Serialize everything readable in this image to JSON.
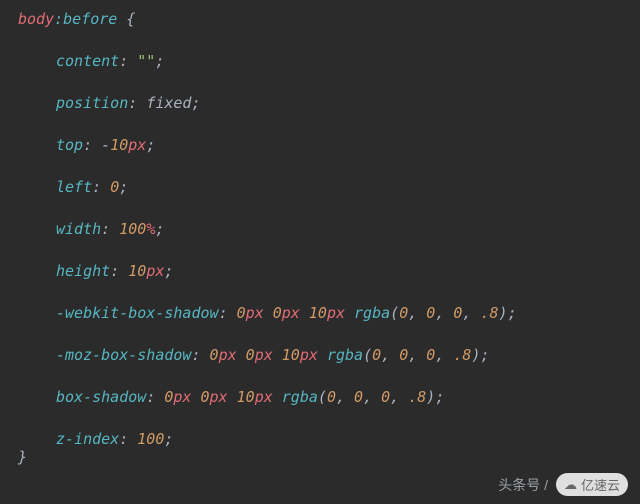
{
  "code": {
    "selector": "body",
    "pseudo": ":before",
    "open": " {",
    "close": "}",
    "decls": [
      {
        "prop": "content",
        "parts": [
          {
            "t": "str",
            "v": "\"\""
          }
        ]
      },
      {
        "prop": "position",
        "parts": [
          {
            "t": "val",
            "v": "fixed"
          }
        ]
      },
      {
        "prop": "top",
        "parts": [
          {
            "t": "punc",
            "v": "-"
          },
          {
            "t": "num",
            "v": "10"
          },
          {
            "t": "unit",
            "v": "px"
          }
        ]
      },
      {
        "prop": "left",
        "parts": [
          {
            "t": "num",
            "v": "0"
          }
        ]
      },
      {
        "prop": "width",
        "parts": [
          {
            "t": "num",
            "v": "100"
          },
          {
            "t": "unit",
            "v": "%"
          }
        ]
      },
      {
        "prop": "height",
        "parts": [
          {
            "t": "num",
            "v": "10"
          },
          {
            "t": "unit",
            "v": "px"
          }
        ]
      },
      {
        "prop": "-webkit-box-shadow",
        "parts": [
          {
            "t": "num",
            "v": "0"
          },
          {
            "t": "unit",
            "v": "px "
          },
          {
            "t": "num",
            "v": "0"
          },
          {
            "t": "unit",
            "v": "px "
          },
          {
            "t": "num",
            "v": "10"
          },
          {
            "t": "unit",
            "v": "px "
          },
          {
            "t": "func",
            "v": "rgba"
          },
          {
            "t": "punc",
            "v": "("
          },
          {
            "t": "num",
            "v": "0"
          },
          {
            "t": "punc",
            "v": ", "
          },
          {
            "t": "num",
            "v": "0"
          },
          {
            "t": "punc",
            "v": ", "
          },
          {
            "t": "num",
            "v": "0"
          },
          {
            "t": "punc",
            "v": ", "
          },
          {
            "t": "num",
            "v": ".8"
          },
          {
            "t": "punc",
            "v": ")"
          }
        ]
      },
      {
        "prop": "-moz-box-shadow",
        "parts": [
          {
            "t": "num",
            "v": "0"
          },
          {
            "t": "unit",
            "v": "px "
          },
          {
            "t": "num",
            "v": "0"
          },
          {
            "t": "unit",
            "v": "px "
          },
          {
            "t": "num",
            "v": "10"
          },
          {
            "t": "unit",
            "v": "px "
          },
          {
            "t": "func",
            "v": "rgba"
          },
          {
            "t": "punc",
            "v": "("
          },
          {
            "t": "num",
            "v": "0"
          },
          {
            "t": "punc",
            "v": ", "
          },
          {
            "t": "num",
            "v": "0"
          },
          {
            "t": "punc",
            "v": ", "
          },
          {
            "t": "num",
            "v": "0"
          },
          {
            "t": "punc",
            "v": ", "
          },
          {
            "t": "num",
            "v": ".8"
          },
          {
            "t": "punc",
            "v": ")"
          }
        ]
      },
      {
        "prop": "box-shadow",
        "parts": [
          {
            "t": "num",
            "v": "0"
          },
          {
            "t": "unit",
            "v": "px "
          },
          {
            "t": "num",
            "v": "0"
          },
          {
            "t": "unit",
            "v": "px "
          },
          {
            "t": "num",
            "v": "10"
          },
          {
            "t": "unit",
            "v": "px "
          },
          {
            "t": "func",
            "v": "rgba"
          },
          {
            "t": "punc",
            "v": "("
          },
          {
            "t": "num",
            "v": "0"
          },
          {
            "t": "punc",
            "v": ", "
          },
          {
            "t": "num",
            "v": "0"
          },
          {
            "t": "punc",
            "v": ", "
          },
          {
            "t": "num",
            "v": "0"
          },
          {
            "t": "punc",
            "v": ", "
          },
          {
            "t": "num",
            "v": ".8"
          },
          {
            "t": "punc",
            "v": ")"
          }
        ]
      },
      {
        "prop": "z-index",
        "parts": [
          {
            "t": "num",
            "v": "100"
          }
        ]
      }
    ]
  },
  "footer": {
    "text": "头条号 / ",
    "brand": "亿速云"
  }
}
